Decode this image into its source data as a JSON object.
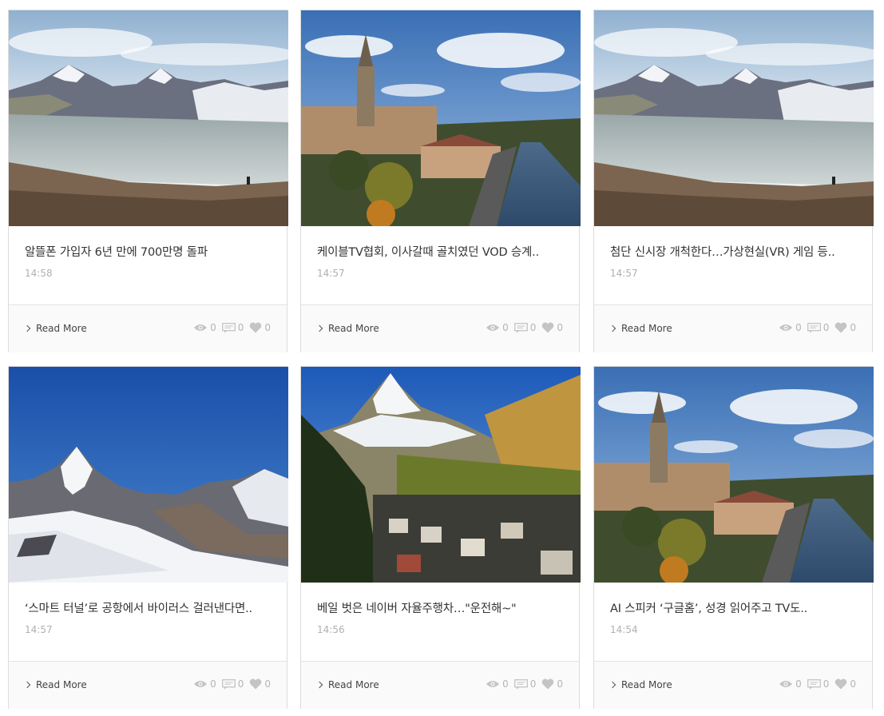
{
  "cards": [
    {
      "title": "알뜰폰 가입자 6년 만에 700만명 돌파",
      "time": "14:58",
      "read_more": "Read More",
      "views": "0",
      "comments": "0",
      "likes": "0",
      "image": "mountain-lake"
    },
    {
      "title": "케이블TV협회, 이사갈때 골치였던 VOD 승계..",
      "time": "14:57",
      "read_more": "Read More",
      "views": "0",
      "comments": "0",
      "likes": "0",
      "image": "cathedral-river"
    },
    {
      "title": "첨단 신시장 개척한다…가상현실(VR) 게임 등..",
      "time": "14:57",
      "read_more": "Read More",
      "views": "0",
      "comments": "0",
      "likes": "0",
      "image": "mountain-lake"
    },
    {
      "title": "‘스마트 터널’로 공항에서 바이러스 걸러낸다면..",
      "time": "14:57",
      "read_more": "Read More",
      "views": "0",
      "comments": "0",
      "likes": "0",
      "image": "matterhorn-snow"
    },
    {
      "title": "베일 벗은 네이버 자율주행차…\"운전해~\"",
      "time": "14:56",
      "read_more": "Read More",
      "views": "0",
      "comments": "0",
      "likes": "0",
      "image": "matterhorn-village"
    },
    {
      "title": "AI 스피커 ‘구글홈’, 성경 읽어주고 TV도..",
      "time": "14:54",
      "read_more": "Read More",
      "views": "0",
      "comments": "0",
      "likes": "0",
      "image": "cathedral-river"
    }
  ],
  "colors": {
    "border": "#dcdcdc",
    "footer_bg": "#fafafa",
    "meta": "#b0b0b0",
    "icon": "#c4c4c4"
  },
  "icons": {
    "views": "eye-icon",
    "comments": "comment-icon",
    "likes": "heart-icon",
    "read_more": "chevron-right-icon"
  }
}
